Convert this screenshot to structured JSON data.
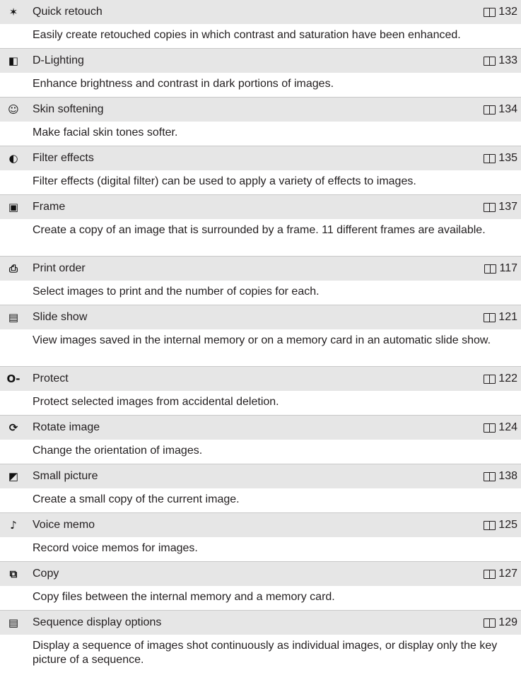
{
  "items": [
    {
      "icon": "retouch-sparkle-icon",
      "glyph": "✶",
      "title": "Quick retouch",
      "page": "132",
      "desc": "Easily create retouched copies in which contrast and saturation have been enhanced."
    },
    {
      "icon": "d-lighting-icon",
      "glyph": "◧",
      "title": "D-Lighting",
      "page": "133",
      "desc": "Enhance brightness and contrast in dark portions of images."
    },
    {
      "icon": "skin-softening-icon",
      "glyph": "☺",
      "title": "Skin softening",
      "page": "134",
      "desc": "Make facial skin tones softer."
    },
    {
      "icon": "filter-effects-icon",
      "glyph": "◐",
      "title": "Filter effects",
      "page": "135",
      "desc": "Filter effects (digital filter) can be used to apply a variety of effects to images."
    },
    {
      "icon": "frame-icon",
      "glyph": "▣",
      "title": "Frame",
      "page": "137",
      "desc": "Create a copy of an image that is surrounded by a frame. 11 different frames are available."
    },
    {
      "icon": "print-order-icon",
      "glyph": "⎙",
      "title": "Print order",
      "page": "117",
      "desc": "Select images to print and the number of copies for each."
    },
    {
      "icon": "slide-show-icon",
      "glyph": "▤",
      "title": "Slide show",
      "page": "121",
      "desc": "View images saved in the internal memory or on a memory card in an automatic slide show."
    },
    {
      "icon": "protect-key-icon",
      "glyph": "O‑",
      "title": "Protect",
      "page": "122",
      "desc": "Protect selected images from accidental deletion."
    },
    {
      "icon": "rotate-image-icon",
      "glyph": "⟳",
      "title": "Rotate image",
      "page": "124",
      "desc": "Change the orientation of images."
    },
    {
      "icon": "small-picture-icon",
      "glyph": "◩",
      "title": "Small picture",
      "page": "138",
      "desc": "Create a small copy of the current image."
    },
    {
      "icon": "voice-memo-microphone-icon",
      "glyph": "♪",
      "title": "Voice memo",
      "page": "125",
      "desc": "Record voice memos for images."
    },
    {
      "icon": "copy-icon",
      "glyph": "⧉",
      "title": "Copy",
      "page": "127",
      "desc": "Copy files between the internal memory and a memory card."
    },
    {
      "icon": "sequence-display-icon",
      "glyph": "▤",
      "title": "Sequence display options",
      "page": "129",
      "desc": "Display a sequence of images shot continuously as individual images, or display only the key picture of a sequence."
    }
  ]
}
